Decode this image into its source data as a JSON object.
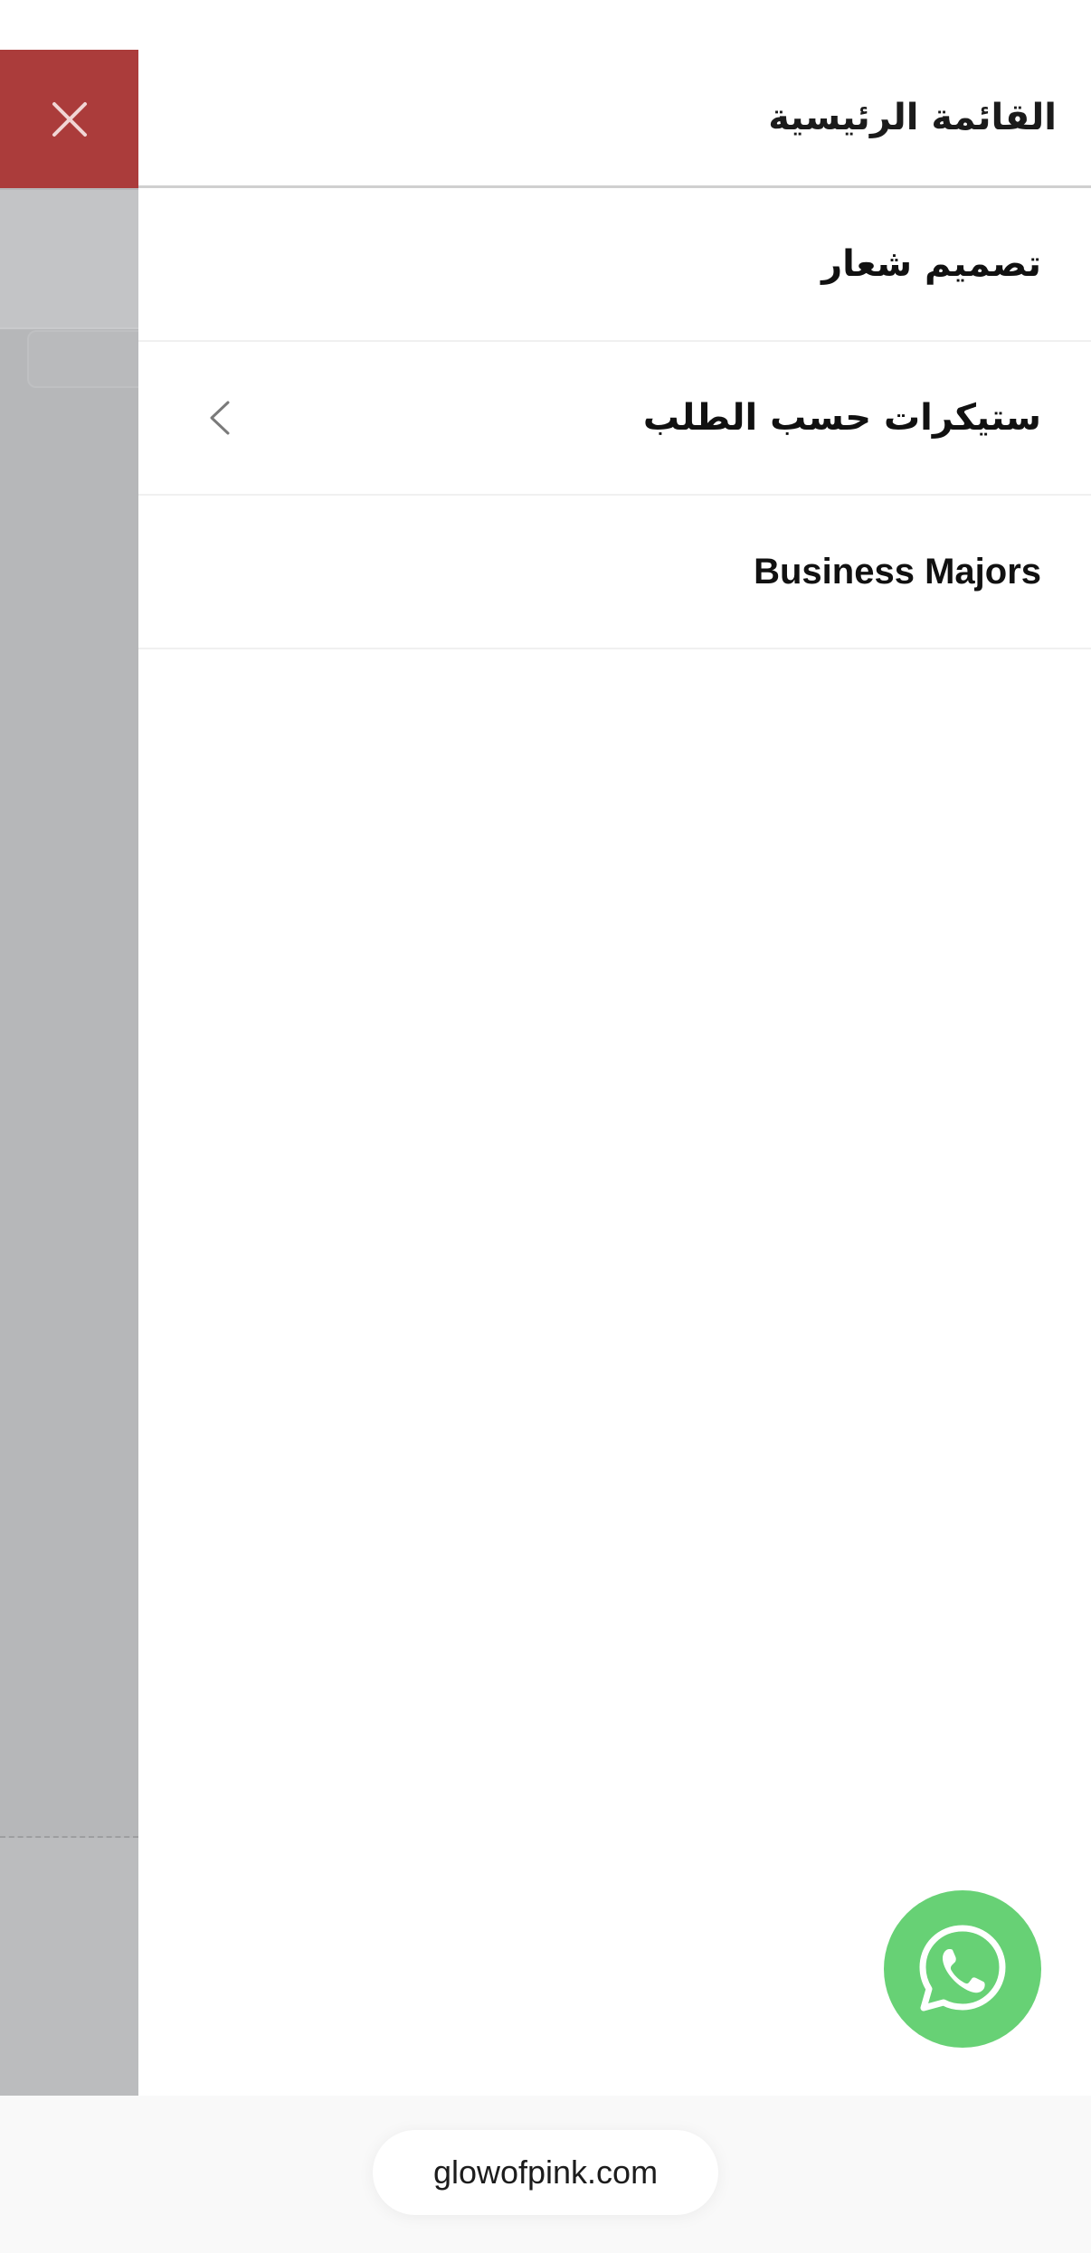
{
  "drawer": {
    "title": "القائمة الرئيسية",
    "items": [
      {
        "label": "تصميم شعار",
        "has_submenu": false
      },
      {
        "label": "ستيكرات حسب الطلب",
        "has_submenu": true
      },
      {
        "label": "Business Majors",
        "has_submenu": false
      }
    ]
  },
  "close_button": {
    "icon": "close-icon"
  },
  "whatsapp_button": {
    "icon": "whatsapp-icon"
  },
  "browser": {
    "url": "glowofpink.com"
  },
  "colors": {
    "close_bg": "#ab3c3b",
    "overlay": "#b6b7b9",
    "whatsapp": "#67d175"
  }
}
